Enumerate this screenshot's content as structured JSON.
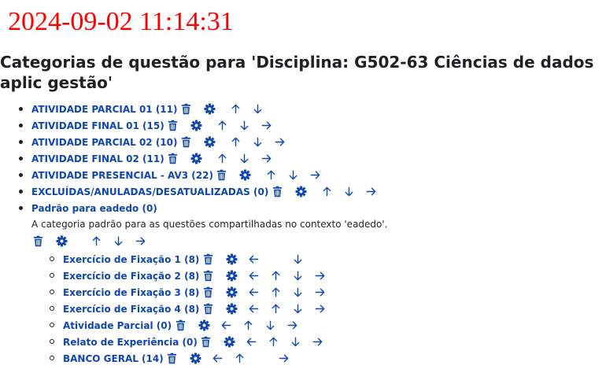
{
  "timestamp": "2024-09-02 11:14:31",
  "page_title": "Categorias de questão para 'Disciplina: G502-63 Ciências de dados aplic gestão'",
  "colors": {
    "link": "#0f47ad",
    "timestamp": "#ff0000",
    "text": "#1d2125"
  },
  "icons": {
    "delete": "trash-icon",
    "edit": "gear-icon",
    "up": "arrow-up-icon",
    "down": "arrow-down-icon",
    "right": "arrow-right-icon",
    "left": "arrow-left-icon"
  },
  "categories": [
    {
      "label": "ATIVIDADE PARCIAL 01 (11)"
    },
    {
      "label": "ATIVIDADE FINAL 01 (15)"
    },
    {
      "label": "ATIVIDADE PARCIAL 02 (10)"
    },
    {
      "label": "ATIVIDADE FINAL 02 (11)"
    },
    {
      "label": "ATIVIDADE PRESENCIAL - AV3 (22)"
    },
    {
      "label": "EXCLUÍDAS/ANULADAS/DESATUALIZADAS (0)"
    },
    {
      "label": "Padrão para eadedo (0)",
      "description": "A categoria padrão para as questões compartilhadas no contexto 'eadedo'.",
      "children": [
        {
          "label": "Exercício de Fixação 1 (8)"
        },
        {
          "label": "Exercício de Fixação 2 (8)"
        },
        {
          "label": "Exercício de Fixação 3 (8)"
        },
        {
          "label": "Exercício de Fixação 4 (8)"
        },
        {
          "label": "Atividade Parcial (0)"
        },
        {
          "label": "Relato de Experiência (0)"
        },
        {
          "label": "BANCO GERAL (14)"
        }
      ]
    }
  ]
}
